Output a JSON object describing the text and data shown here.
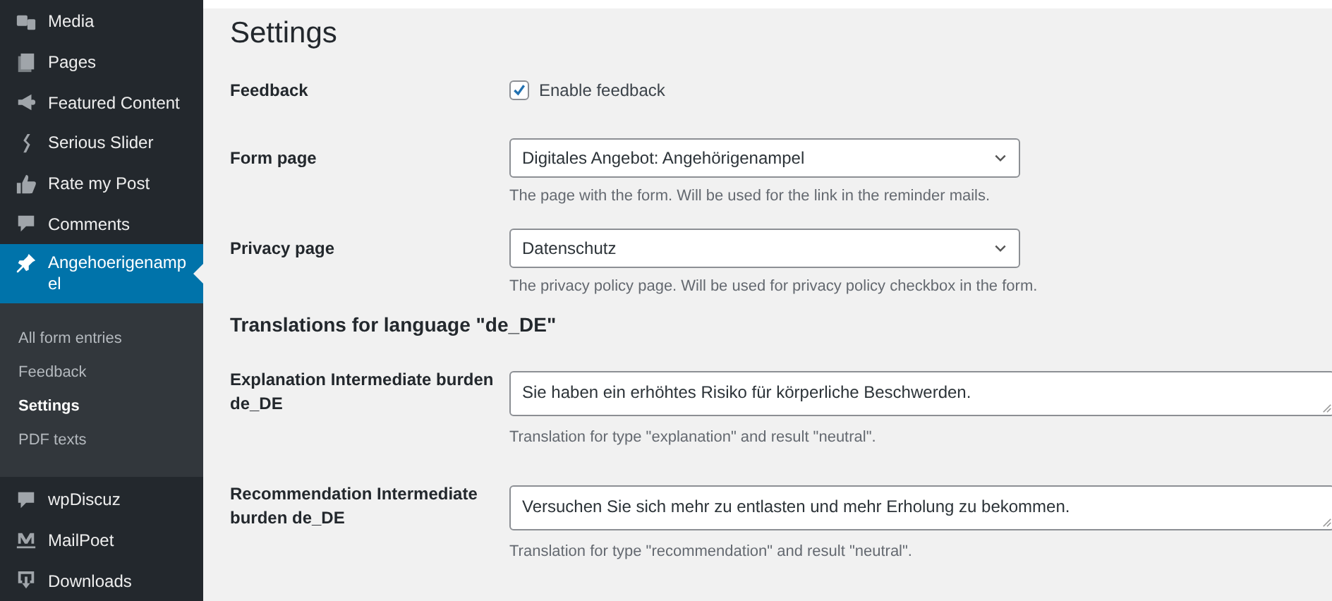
{
  "sidebar": {
    "items": [
      {
        "label": "Media",
        "selected": false
      },
      {
        "label": "Pages",
        "selected": false
      },
      {
        "label": "Featured Content",
        "selected": false
      },
      {
        "label": "Serious Slider",
        "selected": false
      },
      {
        "label": "Rate my Post",
        "selected": false
      },
      {
        "label": "Comments",
        "selected": false
      },
      {
        "label": "Angehoerigenampel",
        "selected": true,
        "children": [
          {
            "label": "All form entries",
            "selected": false
          },
          {
            "label": "Feedback",
            "selected": false
          },
          {
            "label": "Settings",
            "selected": true
          },
          {
            "label": "PDF texts",
            "selected": false
          }
        ]
      },
      {
        "label": "wpDiscuz",
        "selected": false
      },
      {
        "label": "MailPoet",
        "selected": false
      },
      {
        "label": "Downloads",
        "selected": false
      }
    ]
  },
  "page": {
    "title": "Settings",
    "fields": [
      {
        "kind": "checkbox",
        "label": "Feedback",
        "option": "Enable feedback",
        "checked": true
      },
      {
        "kind": "select",
        "label": "Form page",
        "value": "Digitales Angebot: Angehörigenampel",
        "description": "The page with the form. Will be used for the link in the reminder mails."
      },
      {
        "kind": "select",
        "label": "Privacy page",
        "value": "Datenschutz",
        "description": "The privacy policy page. Will be used for privacy policy checkbox in the form."
      }
    ],
    "section": {
      "title": "Translations for language \"de_DE\"",
      "fields": [
        {
          "kind": "textarea",
          "label": "Explanation Intermediate burden de_DE",
          "value": "Sie haben ein erhöhtes Risiko für körperliche Beschwerden.",
          "description": "Translation for type \"explanation\" and result \"neutral\"."
        },
        {
          "kind": "textarea",
          "label": "Recommendation Intermediate burden de_DE",
          "value": "Versuchen Sie sich mehr zu entlasten und mehr Erholung zu bekommen.",
          "description": "Translation for type \"recommendation\" and result \"neutral\"."
        }
      ]
    }
  }
}
